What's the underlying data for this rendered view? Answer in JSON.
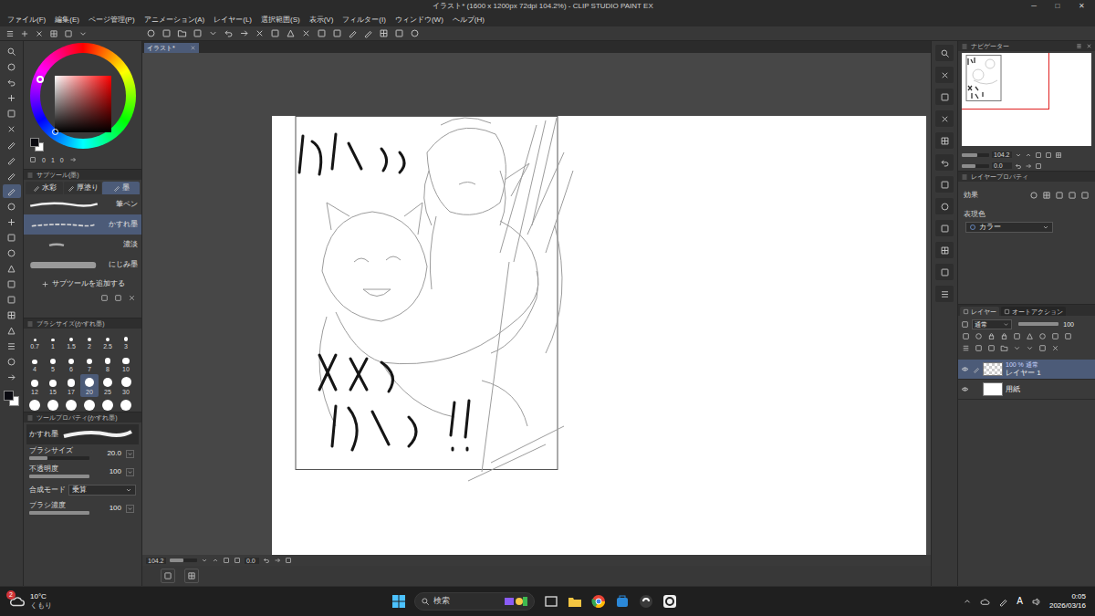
{
  "window": {
    "title": "イラスト* (1600 x 1200px 72dpi 104.2%) - CLIP STUDIO PAINT EX",
    "controls": [
      "─",
      "□",
      "✕"
    ]
  },
  "menu": [
    "ファイル(F)",
    "編集(E)",
    "ページ管理(P)",
    "アニメーション(A)",
    "レイヤー(L)",
    "選択範囲(S)",
    "表示(V)",
    "フィルター(I)",
    "ウィンドウ(W)",
    "ヘルプ(H)"
  ],
  "tools": [
    {
      "selected": false
    },
    {
      "selected": false
    },
    {
      "selected": false
    },
    {
      "selected": false
    },
    {
      "selected": false
    },
    {
      "selected": false
    },
    {
      "selected": false
    },
    {
      "selected": false
    },
    {
      "selected": false
    },
    {
      "selected": true
    },
    {
      "selected": false
    },
    {
      "selected": false
    },
    {
      "selected": false
    },
    {
      "selected": false
    },
    {
      "selected": false
    },
    {
      "selected": false
    },
    {
      "selected": false
    },
    {
      "selected": false
    },
    {
      "selected": false
    },
    {
      "selected": false
    },
    {
      "selected": false
    },
    {
      "selected": false
    }
  ],
  "color_wheel": {
    "hue_color": "#ff0000",
    "main_color": "#0a0a10",
    "sub_color": "#ffffff",
    "values": [
      "0",
      "1",
      "0"
    ]
  },
  "subtool": {
    "title": "サブツール(墨)",
    "groups": [
      {
        "label": "水彩",
        "selected": false
      },
      {
        "label": "厚塗り",
        "selected": false
      },
      {
        "label": "墨",
        "selected": true
      }
    ],
    "items": [
      {
        "label": "筆ペン",
        "selected": false
      },
      {
        "label": "かすれ墨",
        "selected": true
      },
      {
        "label": "濃淡",
        "selected": false
      },
      {
        "label": "にじみ墨",
        "selected": false
      }
    ],
    "add": "サブツールを追加する"
  },
  "brush_size": {
    "title": "ブラシサイズ(かすれ墨)",
    "sizes": [
      {
        "label": "0.7",
        "selected": false
      },
      {
        "label": "1",
        "selected": false
      },
      {
        "label": "1.5",
        "selected": false
      },
      {
        "label": "2",
        "selected": false
      },
      {
        "label": "2.5",
        "selected": false
      },
      {
        "label": "3",
        "selected": false
      },
      {
        "label": "4",
        "selected": false
      },
      {
        "label": "5",
        "selected": false
      },
      {
        "label": "6",
        "selected": false
      },
      {
        "label": "7",
        "selected": false
      },
      {
        "label": "8",
        "selected": false
      },
      {
        "label": "10",
        "selected": false
      },
      {
        "label": "12",
        "selected": false
      },
      {
        "label": "15",
        "selected": false
      },
      {
        "label": "17",
        "selected": false
      },
      {
        "label": "20",
        "selected": true
      },
      {
        "label": "25",
        "selected": false
      },
      {
        "label": "30",
        "selected": false
      }
    ]
  },
  "tool_property": {
    "title": "ツールプロパティ(かすれ墨)",
    "name": "かすれ墨",
    "rows": [
      {
        "label": "ブラシサイズ",
        "value": "20.0",
        "level": 0.3,
        "kind": "slider"
      },
      {
        "label": "不透明度",
        "value": "100",
        "level": 1,
        "kind": "slider"
      },
      {
        "label": "合成モード",
        "value": "乗算",
        "kind": "select"
      },
      {
        "label": "ブラシ濃度",
        "value": "100",
        "level": 1,
        "kind": "slider"
      }
    ]
  },
  "document": {
    "tab": "イラスト*",
    "zoom": "104.2",
    "zoom_level": 0.5,
    "rotation": "0.0"
  },
  "navigator": {
    "title": "ナビゲーター",
    "zoom": "104.2",
    "zoom_level": 0.55,
    "rotation": "0.0",
    "rotation_level": 0.5
  },
  "layer_property": {
    "title": "レイヤープロパティ",
    "effect": "効果",
    "color_label": "表現色",
    "color_mode": "カラー"
  },
  "layers": {
    "tabs": [
      {
        "label": "レイヤー",
        "selected": true
      },
      {
        "label": "オートアクション",
        "selected": false
      }
    ],
    "blend": "通常",
    "opacity": "100",
    "opacity_level": 1,
    "items": [
      {
        "mode": "100 % 通常",
        "name": "レイヤー 1",
        "selected": true,
        "visible": true,
        "kind": "raster"
      },
      {
        "name": "用紙",
        "selected": false,
        "visible": true,
        "kind": "paper"
      }
    ]
  },
  "taskbar": {
    "weather": {
      "badge": "2",
      "temp": "10°C",
      "condition": "くもり"
    },
    "search": {
      "placeholder": "検索"
    },
    "ime": "A",
    "time": "0:05",
    "date": "2026/03/16"
  }
}
